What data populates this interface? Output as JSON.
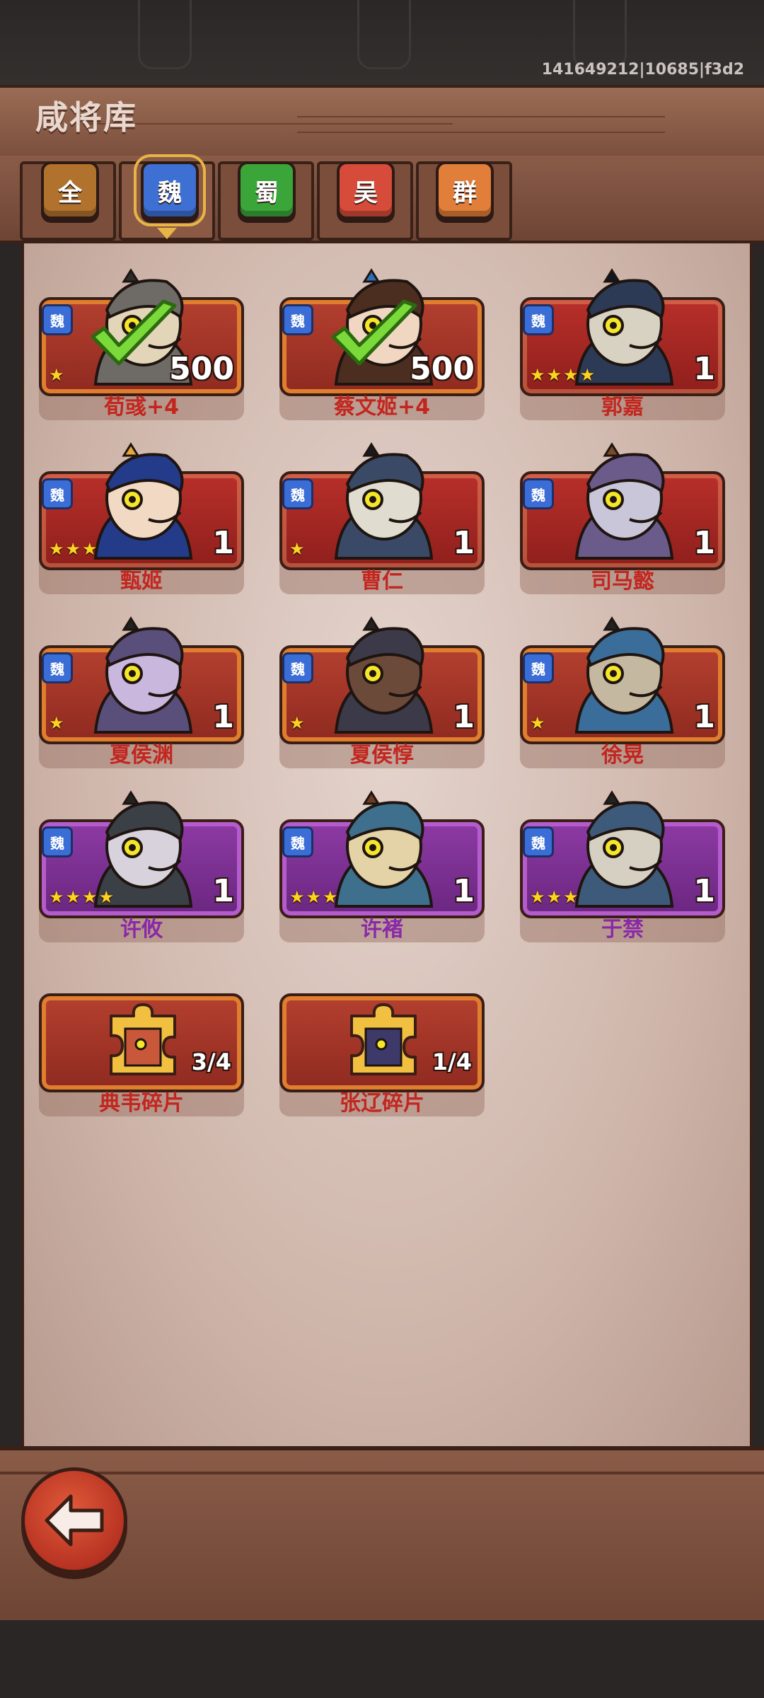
{
  "build_id": "141649212|10685|f3d2",
  "title": "咸将库",
  "tabs": [
    {
      "label": "全",
      "color": "#b0722d"
    },
    {
      "label": "魏",
      "color": "#3e6fd3",
      "active": true
    },
    {
      "label": "蜀",
      "color": "#3aa63a"
    },
    {
      "label": "吴",
      "color": "#d64b3a"
    },
    {
      "label": "群",
      "color": "#e07e3a"
    }
  ],
  "colors": {
    "name_red": "#c2261f",
    "name_purple": "#8a28a8",
    "accent_gold": "#e8b446"
  },
  "generals": [
    {
      "name": "荀彧+4",
      "faction": "魏",
      "stars": "★",
      "count": "500",
      "rarity": "orange",
      "collected": true,
      "icon": "checkmark-icon"
    },
    {
      "name": "蔡文姬+4",
      "faction": "魏",
      "stars": "",
      "count": "500",
      "rarity": "orange",
      "collected": true,
      "icon": "checkmark-icon"
    },
    {
      "name": "郭嘉",
      "faction": "魏",
      "stars": "★★★★",
      "count": "1",
      "rarity": "red"
    },
    {
      "name": "甄姬",
      "faction": "魏",
      "stars": "★★★",
      "count": "1",
      "rarity": "red"
    },
    {
      "name": "曹仁",
      "faction": "魏",
      "stars": "★",
      "count": "1",
      "rarity": "red"
    },
    {
      "name": "司马懿",
      "faction": "魏",
      "stars": "",
      "count": "1",
      "rarity": "red"
    },
    {
      "name": "夏侯渊",
      "faction": "魏",
      "stars": "★",
      "count": "1",
      "rarity": "orange"
    },
    {
      "name": "夏侯惇",
      "faction": "魏",
      "stars": "★",
      "count": "1",
      "rarity": "orange"
    },
    {
      "name": "徐晃",
      "faction": "魏",
      "stars": "★",
      "count": "1",
      "rarity": "orange"
    },
    {
      "name": "许攸",
      "faction": "魏",
      "stars": "★★★★",
      "count": "1",
      "rarity": "purple"
    },
    {
      "name": "许褚",
      "faction": "魏",
      "stars": "★★★",
      "count": "1",
      "rarity": "purple"
    },
    {
      "name": "于禁",
      "faction": "魏",
      "stars": "★★★",
      "count": "1",
      "rarity": "purple"
    }
  ],
  "fragments": [
    {
      "name": "典韦碎片",
      "progress": "3/4"
    },
    {
      "name": "张辽碎片",
      "progress": "1/4"
    }
  ]
}
